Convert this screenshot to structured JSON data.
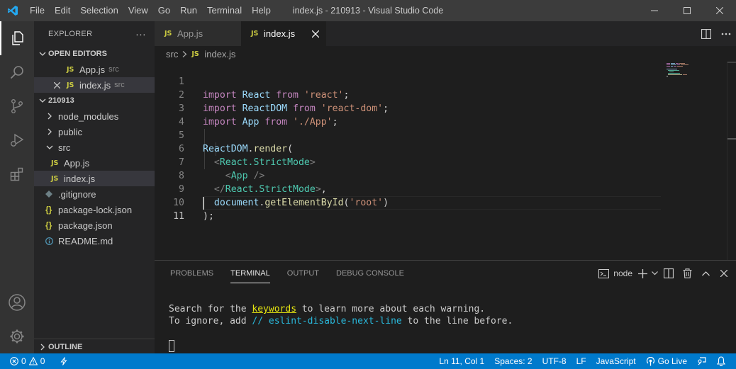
{
  "window": {
    "title": "index.js - 210913 - Visual Studio Code",
    "menu": [
      "File",
      "Edit",
      "Selection",
      "View",
      "Go",
      "Run",
      "Terminal",
      "Help"
    ]
  },
  "explorer": {
    "header": "EXPLORER",
    "more": "···",
    "open_editors_label": "OPEN EDITORS",
    "open_editors": [
      {
        "name": "App.js",
        "hint": "src"
      },
      {
        "name": "index.js",
        "hint": "src"
      }
    ],
    "project_label": "210913",
    "tree": {
      "node_modules": "node_modules",
      "public": "public",
      "src": "src",
      "app_js": "App.js",
      "index_js": "index.js",
      "gitignore": ".gitignore",
      "package_lock": "package-lock.json",
      "package": "package.json",
      "readme": "README.md"
    },
    "outline_label": "OUTLINE",
    "js_badge": "JS",
    "brace_badge": "{}"
  },
  "tabs": [
    {
      "label": "App.js",
      "active": false
    },
    {
      "label": "index.js",
      "active": true
    }
  ],
  "breadcrumb": {
    "folder": "src",
    "file": "index.js"
  },
  "editor": {
    "line_numbers": [
      "1",
      "2",
      "3",
      "4",
      "5",
      "6",
      "7",
      "8",
      "9",
      "10",
      "11"
    ],
    "lines": {
      "l1": {
        "a": "import",
        "b": " React ",
        "c": "from",
        "d": " 'react'",
        "e": ";"
      },
      "l2": {
        "a": "import",
        "b": " ReactDOM ",
        "c": "from",
        "d": " 'react-dom'",
        "e": ";"
      },
      "l3": {
        "a": "import",
        "b": " App ",
        "c": "from",
        "d": " './App'",
        "e": ";"
      },
      "l5": {
        "a": "ReactDOM",
        "b": ".",
        "c": "render",
        "d": "("
      },
      "l6": {
        "a": "  <",
        "b": "React.StrictMode",
        "c": ">"
      },
      "l7": {
        "a": "    <",
        "b": "App",
        "c": " />"
      },
      "l8": {
        "a": "  </",
        "b": "React.StrictMode",
        "c": ">",
        "d": ","
      },
      "l9": {
        "a": "  document",
        "b": ".",
        "c": "getElementById",
        "d": "(",
        "e": "'root'",
        "f": ")"
      },
      "l10": {
        "a": ");"
      }
    }
  },
  "panel": {
    "tabs": [
      "PROBLEMS",
      "TERMINAL",
      "OUTPUT",
      "DEBUG CONSOLE"
    ],
    "active_tab": "TERMINAL",
    "terminal_name": "node",
    "terminal": {
      "line1_a": "Search for the ",
      "line1_kw": "keywords",
      "line1_b": " to learn more about each warning.",
      "line2_a": "To ignore, add ",
      "line2_cmt": "// eslint-disable-next-line",
      "line2_b": " to the line before."
    }
  },
  "statusbar": {
    "errors": "0",
    "warnings": "0",
    "position": "Ln 11, Col 1",
    "spaces": "Spaces: 2",
    "encoding": "UTF-8",
    "eol": "LF",
    "language": "JavaScript",
    "golive": "Go Live"
  },
  "colors": {
    "accent": "#007acc",
    "titlebar": "#3c3c3c",
    "sidebar": "#252526",
    "editor_bg": "#1e1e1e"
  }
}
